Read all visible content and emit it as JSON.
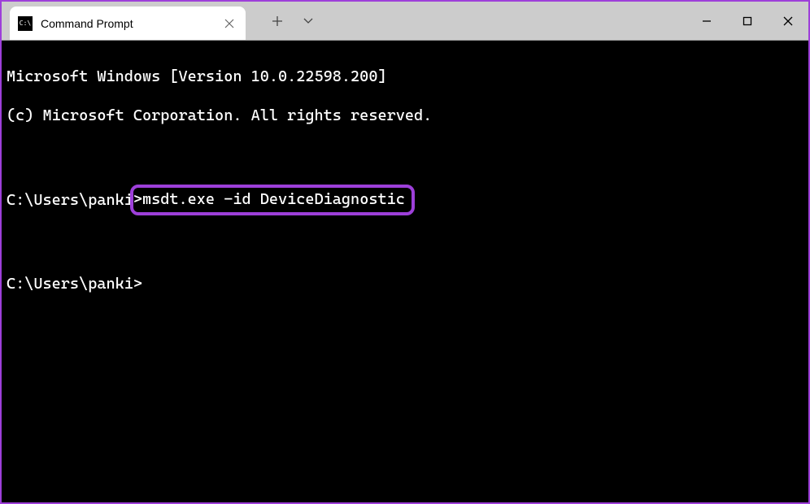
{
  "window": {
    "tab_title": "Command Prompt"
  },
  "terminal": {
    "line1": "Microsoft Windows [Version 10.0.22598.200]",
    "line2": "(c) Microsoft Corporation. All rights reserved.",
    "prompt1_prefix": "C:\\Users\\panki",
    "prompt1_arrow": ">",
    "command": "msdt.exe -id DeviceDiagnostic",
    "prompt2": "C:\\Users\\panki>"
  }
}
